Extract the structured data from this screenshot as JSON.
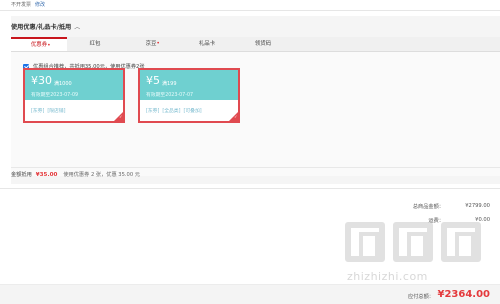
{
  "invoice": {
    "status": "不开发票",
    "edit_label": "修改"
  },
  "coupon_panel": {
    "title": "使用优惠/礼品卡/抵用",
    "toggle_icon": "chevron-up-icon",
    "tabs": [
      {
        "label": "优惠券",
        "active": true,
        "dot": true
      },
      {
        "label": "红包",
        "active": false,
        "dot": false
      },
      {
        "label": "京豆",
        "active": false,
        "dot": true
      },
      {
        "label": "礼品卡",
        "active": false,
        "dot": false
      },
      {
        "label": "领货码",
        "active": false,
        "dot": false
      }
    ],
    "combo_text": "优惠组合推荐，共抵用35.00元，使用优惠券2张",
    "combo_checked": true,
    "coupons": [
      {
        "amount": "¥30",
        "condition": "满1000",
        "expiry": "有效期至2023-07-09",
        "tags": [
          "[东券]",
          "[限店铺]"
        ],
        "selected": true
      },
      {
        "amount": "¥5",
        "condition": "满199",
        "expiry": "有效期至2023-07-07",
        "tags": [
          "[东券]",
          "[全品类]",
          "[可叠加]"
        ],
        "selected": true
      }
    ],
    "summary": {
      "label": "金额抵用",
      "amount": "¥35.00",
      "desc": "使用优惠券 2 张，优惠 35.00 元"
    }
  },
  "totals": [
    {
      "label": "总商品金额：",
      "value": "¥2799.00"
    },
    {
      "label": "运费：",
      "value": "¥0.00"
    }
  ],
  "payment": {
    "label": "应付总额：",
    "amount": "¥2364.00"
  },
  "watermark": {
    "text": "zhizhizhi.com"
  },
  "colors": {
    "accent": "#e4393c",
    "coupon_bg": "#6fd0d0",
    "link": "#3a6fb0"
  }
}
